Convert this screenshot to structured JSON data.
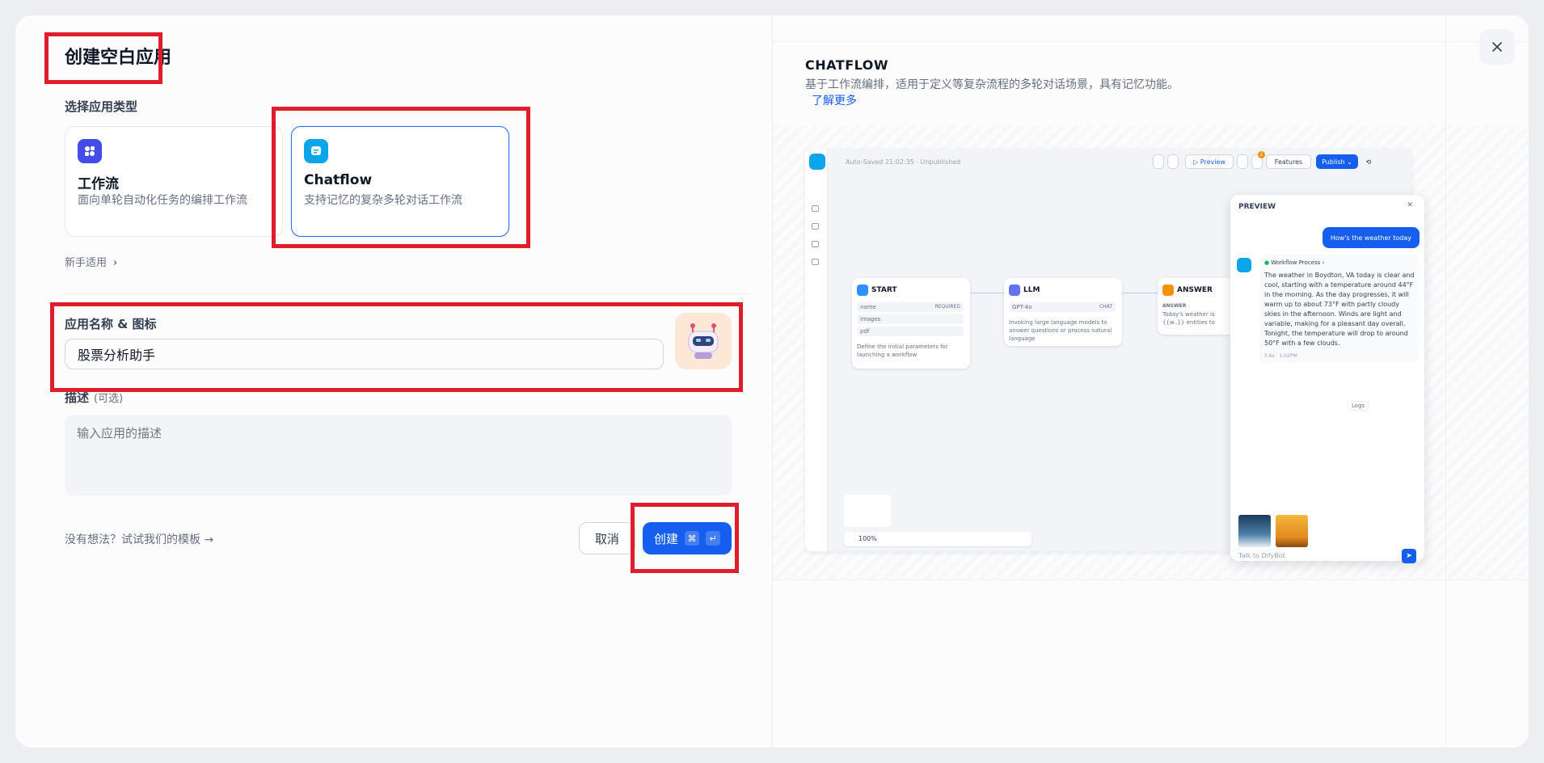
{
  "left": {
    "title": "创建空白应用",
    "type_label": "选择应用类型",
    "cards": [
      {
        "title": "工作流",
        "desc": "面向单轮自动化任务的编排工作流"
      },
      {
        "title": "Chatflow",
        "desc": "支持记忆的复杂多轮对话工作流"
      }
    ],
    "beginner_link": "新手适用",
    "name_label": "应用名称 & 图标",
    "name_value": "股票分析助手",
    "desc_label": "描述",
    "desc_optional": "(可选)",
    "desc_placeholder": "输入应用的描述",
    "template_link": "没有想法？试试我们的模板",
    "cancel": "取消",
    "create": "创建",
    "kbd_cmd": "⌘",
    "kbd_enter": "↵"
  },
  "right": {
    "title": "CHATFLOW",
    "desc": "基于工作流编排，适用于定义等复杂流程的多轮对话场景，具有记忆功能。",
    "more": "了解更多",
    "mock": {
      "autosave": "Auto-Saved 21:02:35 · Unpublished",
      "preview_btn": "▷ Preview",
      "features": "Features",
      "publish": "Publish ⌄",
      "badge": "2",
      "start": {
        "title": "START",
        "vars": [
          "name",
          "images",
          "pdf"
        ],
        "req": "REQUIRED",
        "desc": "Define the initial parameters for launching a workflow"
      },
      "llm": {
        "title": "LLM",
        "model": "GPT-4o",
        "mode": "CHAT",
        "desc": "Invoking large language models to answer questions or process natural language"
      },
      "answer": {
        "title": "ANSWER",
        "sub": "ANSWER",
        "desc": "Today's weather is {{w..}} entities to extract."
      },
      "panel_title": "PREVIEW",
      "user_msg": "How's the weather today",
      "process": "Workflow Process",
      "reply": "The weather in Boydton, VA today is clear and cool, starting with a temperature around 44°F in the morning. As the day progresses, it will warm up to about 73°F with partly cloudy skies in the afternoon. Winds are light and variable, making for a pleasant day overall. Tonight, the temperature will drop to around 50°F with a few clouds.",
      "meta": "5.6s · 1:02PM",
      "logs": "Logs",
      "input_placeholder": "Talk to DifyBot",
      "zoom": "100%"
    }
  },
  "colors": {
    "accent": "#155eef",
    "highlight": "#e01e2b",
    "selected_border": "#296dff"
  }
}
